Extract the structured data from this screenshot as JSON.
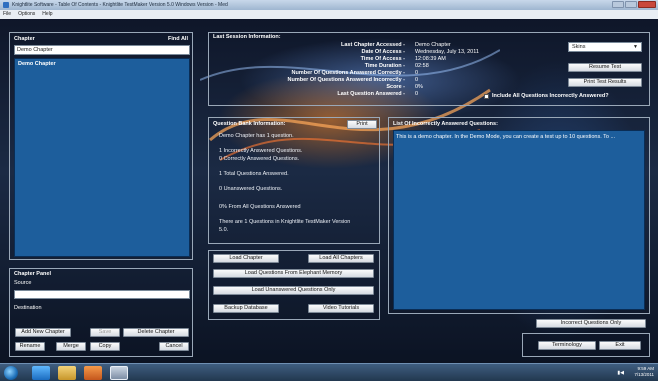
{
  "window": {
    "title": "Knightlite Software - Table Of Contents - Knightlite TestMaker Version 5.0  Windows Version - Med"
  },
  "menu": {
    "items": [
      "File",
      "Options",
      "Help"
    ]
  },
  "chapter_panel": {
    "title": "Chapter",
    "find_all": "Find All",
    "input_value": "Demo Chapter",
    "items": [
      "Demo Chapter"
    ]
  },
  "cp": {
    "title": "Chapter Panel",
    "source_label": "Source",
    "destination_label": "Destination",
    "add_new": "Add New Chapter",
    "save": "Save",
    "delete": "Delete Chapter",
    "rename": "Rename",
    "merge": "Merge",
    "copy": "Copy",
    "cancel": "Cancel"
  },
  "session": {
    "title": "Last Session Information:",
    "rows": [
      {
        "label": "Last Chapter Accessed -",
        "value": "Demo Chapter"
      },
      {
        "label": "Date Of Access -",
        "value": "Wednesday, July 13, 2011"
      },
      {
        "label": "Time Of Access -",
        "value": "12:08:39 AM"
      },
      {
        "label": "Time Duration -",
        "value": "02:58"
      },
      {
        "label": "Number Of Questions Answered Correctly -",
        "value": "0"
      },
      {
        "label": "Number Of Questions Answered Incorrectly -",
        "value": "0"
      },
      {
        "label": "Score -",
        "value": "0%"
      },
      {
        "label": "Last Question Answered -",
        "value": "0"
      }
    ],
    "skins": "Skins",
    "resume_test": "Resume Test",
    "print_results": "Print Test Results",
    "include_all": "Include All Questions Incorrectly Answered?"
  },
  "qb": {
    "title": "Question Bank Information:",
    "print": "Print",
    "lines": [
      "Demo Chapter has 1 question.",
      "1  Incorrectly Answered Questions.",
      "0  Correctly Answered Questions.",
      "1  Total Questions Answered.",
      "0 Unanswered Questions.",
      "0%  From All Questions Answered",
      "There are 1 Questions in Knightlite TestMaker Version",
      "5.0."
    ]
  },
  "wrong": {
    "title": "List Of Incorrectly Answered Questions:",
    "items": [
      "This is a demo chapter.  In the Demo Mode, you can create a test up to 10 questions.  To ..."
    ]
  },
  "actions": {
    "load_chapter": "Load Chapter",
    "load_all": "Load All Chapters",
    "load_elephant": "Load Questions From Elephant Memory",
    "load_unanswered": "Load Unanswered Questions Only",
    "backup": "Backup Database",
    "tutorials": "Video Tutorials"
  },
  "bottom": {
    "incorrect_only": "Incorrect Questions Only",
    "terminology": "Terminology",
    "exit": "Exit"
  },
  "taskbar": {
    "time": "9:59 AM",
    "date": "7/13/2011"
  }
}
